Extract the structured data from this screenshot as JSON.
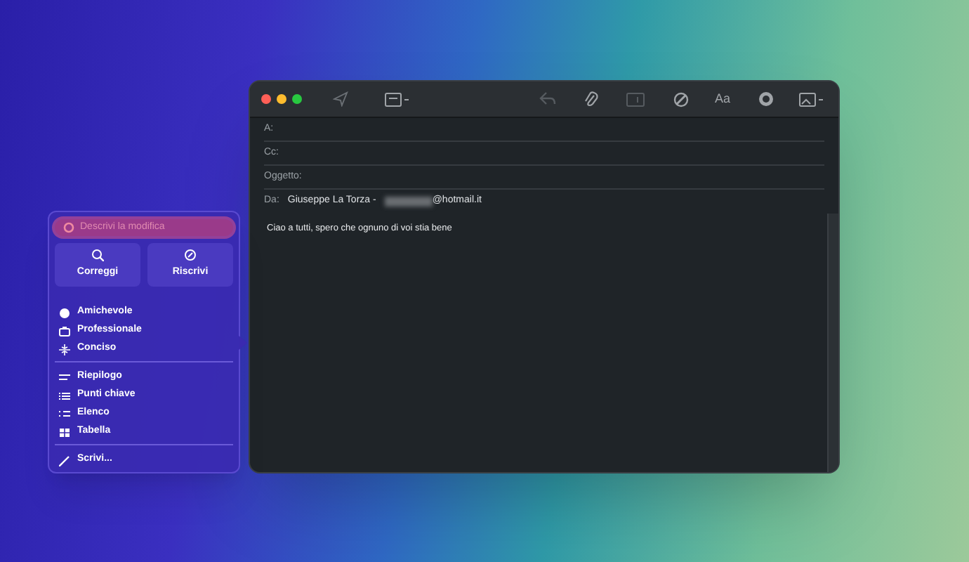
{
  "mail_window": {
    "toolbar": {
      "font_button": "Aa"
    },
    "fields": [
      {
        "label": "A:"
      },
      {
        "label": "Cc:"
      },
      {
        "label": "Oggetto:"
      }
    ],
    "from": {
      "label": "Da:",
      "name": "Giuseppe La Torza -",
      "email_suffix": "@hotmail.it"
    },
    "body": "Ciao a tutti, spero che ognuno di voi stia bene"
  },
  "writing_tools": {
    "search": {
      "placeholder": "Descrivi la modifica"
    },
    "buttons": [
      {
        "label": "Correggi",
        "kind": "proofread"
      },
      {
        "label": "Riscrivi",
        "kind": "rewrite"
      }
    ],
    "groups": [
      [
        {
          "label": "Amichevole",
          "kind": "friendly"
        },
        {
          "label": "Professionale",
          "kind": "professional"
        },
        {
          "label": "Conciso",
          "kind": "concise"
        }
      ],
      [
        {
          "label": "Riepilogo",
          "kind": "summary"
        },
        {
          "label": "Punti chiave",
          "kind": "keypoints"
        },
        {
          "label": "Elenco",
          "kind": "list"
        },
        {
          "label": "Tabella",
          "kind": "table"
        }
      ],
      [
        {
          "label": "Scrivi...",
          "kind": "compose"
        }
      ]
    ]
  }
}
